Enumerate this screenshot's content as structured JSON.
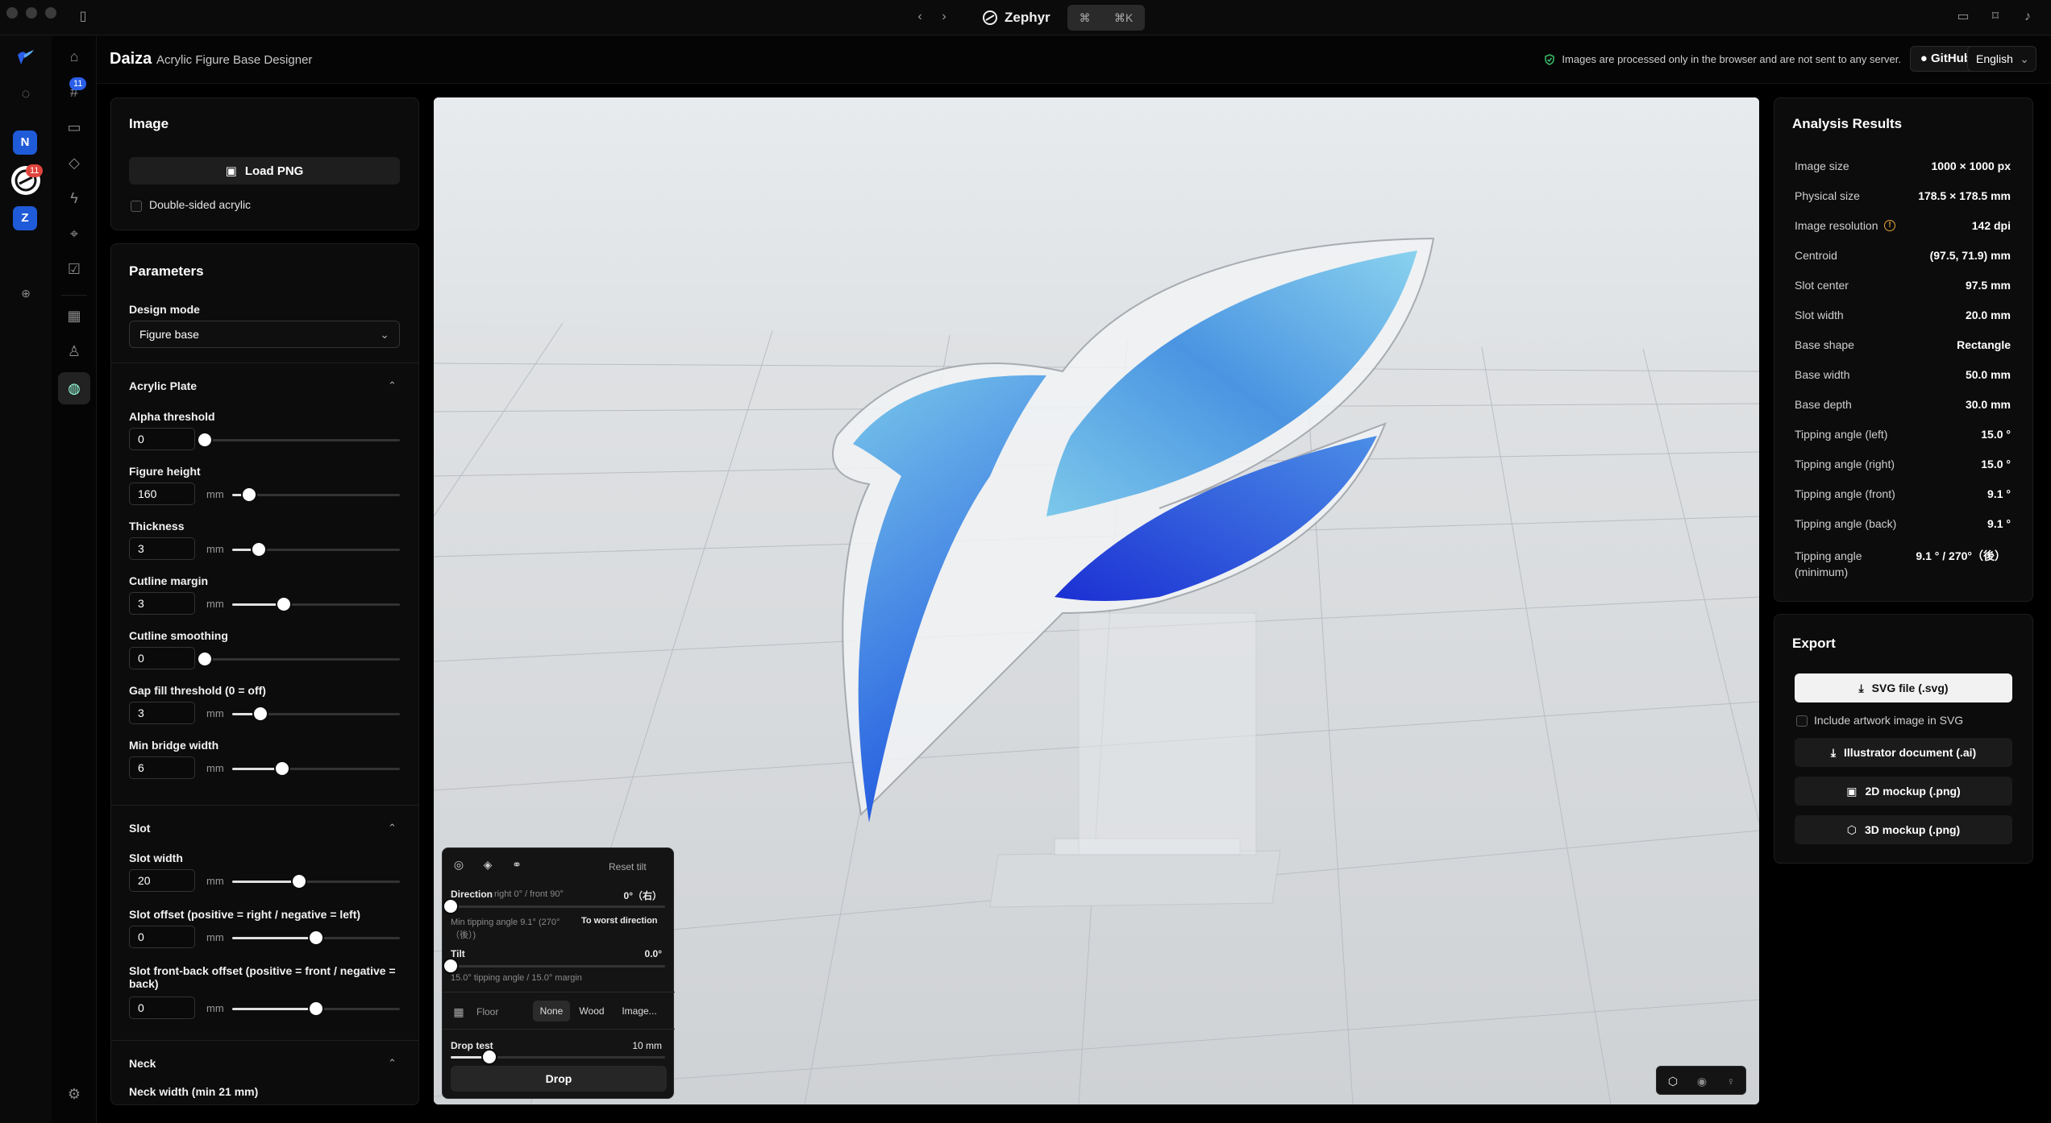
{
  "titlebar": {
    "app_name": "Zephyr",
    "cmd_symbol": "⌘",
    "cmd_shortcut": "⌘K"
  },
  "rail": {
    "badge_hash": "11",
    "badge_zephyr": "11",
    "workspace_n": "N",
    "workspace_z": "Z"
  },
  "header": {
    "brand": "Daiza",
    "subtitle": "Acrylic Figure Base Designer",
    "privacy_note": "Images are processed only in the browser and are not sent to any server.",
    "github_label": "GitHub",
    "language": "English"
  },
  "image_panel": {
    "title": "Image",
    "load_button": "Load PNG",
    "double_sided_label": "Double-sided acrylic"
  },
  "parameters": {
    "title": "Parameters",
    "design_mode_label": "Design mode",
    "design_mode_value": "Figure base",
    "acrylic_section": "Acrylic Plate",
    "fields": [
      {
        "label": "Alpha threshold",
        "value": "0",
        "unit": "",
        "fraction": 0.0
      },
      {
        "label": "Figure height",
        "value": "160",
        "unit": "mm",
        "fraction": 0.1
      },
      {
        "label": "Thickness",
        "value": "3",
        "unit": "mm",
        "fraction": 0.16
      },
      {
        "label": "Cutline margin",
        "value": "3",
        "unit": "mm",
        "fraction": 0.31
      },
      {
        "label": "Cutline smoothing",
        "value": "0",
        "unit": "",
        "fraction": 0.0
      },
      {
        "label": "Gap fill threshold (0 = off)",
        "value": "3",
        "unit": "mm",
        "fraction": 0.17
      },
      {
        "label": "Min bridge width",
        "value": "6",
        "unit": "mm",
        "fraction": 0.3
      }
    ],
    "slot_section": "Slot",
    "slot_fields": [
      {
        "label": "Slot width",
        "value": "20",
        "unit": "mm",
        "fraction": 0.4
      },
      {
        "label": "Slot offset (positive = right / negative = left)",
        "value": "0",
        "unit": "mm",
        "fraction": 0.5
      },
      {
        "label": "Slot front-back offset (positive = front / negative = back)",
        "value": "0",
        "unit": "mm",
        "fraction": 0.5
      }
    ],
    "neck_section": "Neck",
    "neck_width_label": "Neck width (min 21 mm)"
  },
  "viewport_overlay": {
    "reset_tilt": "Reset tilt",
    "direction_label": "Direction",
    "direction_hint": "right 0° / front 90°",
    "direction_value": "0°（右）",
    "min_tipping_note": "Min tipping angle 9.1° (270°（後）)",
    "worst_direction": "To worst direction",
    "tilt_label": "Tilt",
    "tilt_value": "0.0°",
    "tilt_note": "15.0° tipping angle / 15.0° margin",
    "floor_label": "Floor",
    "floor_options": [
      "None",
      "Wood",
      "Image..."
    ],
    "floor_selected": "None",
    "drop_test_label": "Drop test",
    "drop_test_value": "10 mm",
    "drop_button": "Drop"
  },
  "analysis": {
    "title": "Analysis Results",
    "rows": [
      {
        "key": "Image size",
        "value": "1000 × 1000 px"
      },
      {
        "key": "Physical size",
        "value": "178.5 × 178.5 mm"
      },
      {
        "key": "Image resolution",
        "value": "142 dpi"
      },
      {
        "key": "Centroid",
        "value": "(97.5, 71.9) mm"
      },
      {
        "key": "Slot center",
        "value": "97.5 mm"
      },
      {
        "key": "Slot width",
        "value": "20.0 mm"
      },
      {
        "key": "Base shape",
        "value": "Rectangle"
      },
      {
        "key": "Base width",
        "value": "50.0 mm"
      },
      {
        "key": "Base depth",
        "value": "30.0 mm"
      },
      {
        "key": "Tipping angle (left)",
        "value": "15.0 °"
      },
      {
        "key": "Tipping angle (right)",
        "value": "15.0 °"
      },
      {
        "key": "Tipping angle (front)",
        "value": "9.1 °"
      },
      {
        "key": "Tipping angle (back)",
        "value": "9.1 °"
      }
    ],
    "min_key_line1": "Tipping angle",
    "min_key_line2": "(minimum)",
    "min_value": "9.1 ° / 270°（後）"
  },
  "export": {
    "title": "Export",
    "svg_button": "SVG file (.svg)",
    "include_artwork_label": "Include artwork image in SVG",
    "ai_button": "Illustrator document (.ai)",
    "mockup2d_button": "2D mockup (.png)",
    "mockup3d_button": "3D mockup (.png)"
  },
  "colors": {
    "accent_blue": "#2b5ee8",
    "wing_light": "#6fc2e8",
    "wing_dark": "#1532d6",
    "warning": "#e8a33b",
    "privacy_shield": "#3bbf6a"
  }
}
